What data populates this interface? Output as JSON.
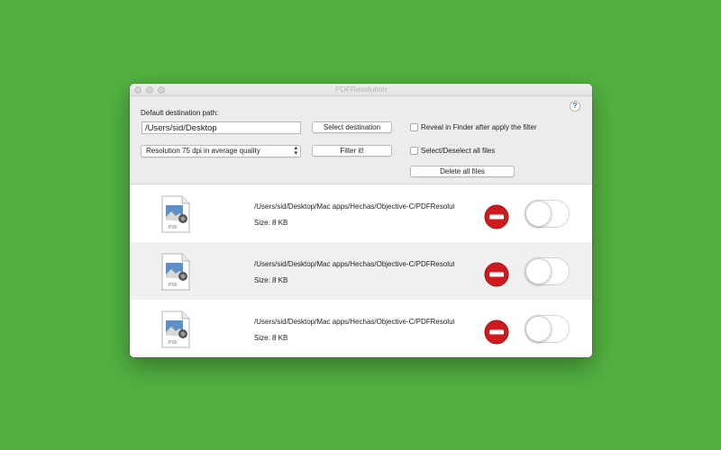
{
  "window": {
    "title": "PDFResolution",
    "help_label": "?"
  },
  "toolbar": {
    "destination_label": "Default destination path:",
    "destination_value": "/Users/sid/Desktop",
    "select_destination_label": "Select destination",
    "resolution_selected": "Resolution 75 dpi in average quality",
    "filter_label": "Filter it!",
    "reveal_label": "Reveal in Finder after apply the filter",
    "select_all_label": "Select/Deselect all files",
    "delete_all_label": "Delete all files"
  },
  "files": [
    {
      "path": "/Users/sid/Desktop/Mac apps/Hechas/Objective-C/PDFResolution",
      "size": "Size: 8 KB",
      "icon_label": "PDF",
      "enabled": false
    },
    {
      "path": "/Users/sid/Desktop/Mac apps/Hechas/Objective-C/PDFResolution",
      "size": "Size: 8 KB",
      "icon_label": "PDF",
      "enabled": false
    },
    {
      "path": "/Users/sid/Desktop/Mac apps/Hechas/Objective-C/PDFResolution",
      "size": "Size: 8 KB",
      "icon_label": "PDF",
      "enabled": false
    }
  ],
  "colors": {
    "background": "#52b141",
    "remove": "#d0191f"
  }
}
